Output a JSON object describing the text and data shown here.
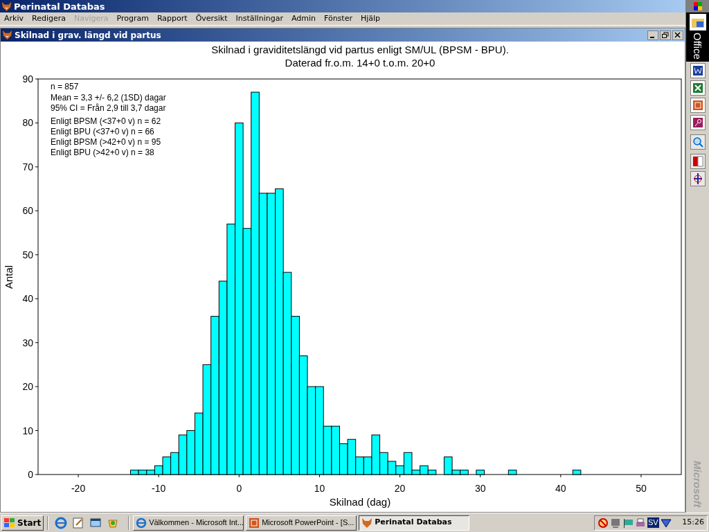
{
  "window": {
    "title": "Perinatal Databas"
  },
  "menu": [
    {
      "label": "Arkiv",
      "disabled": false
    },
    {
      "label": "Redigera",
      "disabled": false
    },
    {
      "label": "Navigera",
      "disabled": true
    },
    {
      "label": "Program",
      "disabled": false
    },
    {
      "label": "Rapport",
      "disabled": false
    },
    {
      "label": "Översikt",
      "disabled": false
    },
    {
      "label": "Inställningar",
      "disabled": false
    },
    {
      "label": "Admin",
      "disabled": false
    },
    {
      "label": "Fönster",
      "disabled": false
    },
    {
      "label": "Hjälp",
      "disabled": false
    }
  ],
  "document_window": {
    "title": "Skilnad i grav. längd vid partus"
  },
  "chart": {
    "subtitle": "Daterad fr.o.m. 14+0 t.o.m. 20+0",
    "chart_data": {
      "type": "bar",
      "title": "Skilnad i graviditetslängd vid partus enligt SM/UL (BPSM - BPU).",
      "xlabel": "Skilnad (dag)",
      "ylabel": "Antal",
      "x": [
        -13,
        -12,
        -11,
        -10,
        -9,
        -8,
        -7,
        -6,
        -5,
        -4,
        -3,
        -2,
        -1,
        0,
        1,
        2,
        3,
        4,
        5,
        6,
        7,
        8,
        9,
        10,
        11,
        12,
        13,
        14,
        15,
        16,
        17,
        18,
        19,
        20,
        21,
        22,
        23,
        24,
        26,
        27,
        28,
        30,
        34,
        42
      ],
      "series": [
        {
          "color": "#00ffff",
          "values": [
            1,
            1,
            1,
            2,
            4,
            5,
            9,
            10,
            14,
            25,
            36,
            44,
            57,
            80,
            56,
            87,
            64,
            64,
            65,
            46,
            36,
            27,
            20,
            20,
            11,
            11,
            7,
            8,
            4,
            4,
            9,
            5,
            3,
            2,
            5,
            1,
            2,
            1,
            4,
            1,
            1,
            1,
            1,
            1
          ]
        }
      ],
      "xlim": [
        -25,
        55
      ],
      "ylim": [
        0,
        90
      ],
      "xticks": [
        -20,
        -10,
        0,
        10,
        20,
        30,
        40,
        50
      ],
      "yticks": [
        0,
        10,
        20,
        30,
        40,
        50,
        60,
        70,
        80,
        90
      ],
      "annotations": [
        "n = 857",
        "Mean = 3,3 +/- 6,2 (1SD) dagar",
        "95% CI = Från 2,9 till 3,7 dagar",
        "Enligt BPSM (<37+0 v) n = 62",
        "Enligt BPU  (<37+0 v) n = 66",
        "Enligt BPSM (>42+0 v) n = 95",
        "Enligt BPU  (>42+0 v) n = 38"
      ]
    }
  },
  "office_bar": {
    "title": "Office",
    "brand": "Microsoft"
  },
  "taskbar": {
    "start": "Start",
    "tasks": [
      {
        "label": "Välkommen - Microsoft Int...",
        "kind": "browser",
        "selected": false
      },
      {
        "label": "Microsoft PowerPoint - [S...",
        "kind": "slides",
        "selected": false
      },
      {
        "label": "Perinatal Databas",
        "kind": "app",
        "selected": true
      }
    ],
    "language": "SV",
    "clock": "15:26"
  }
}
